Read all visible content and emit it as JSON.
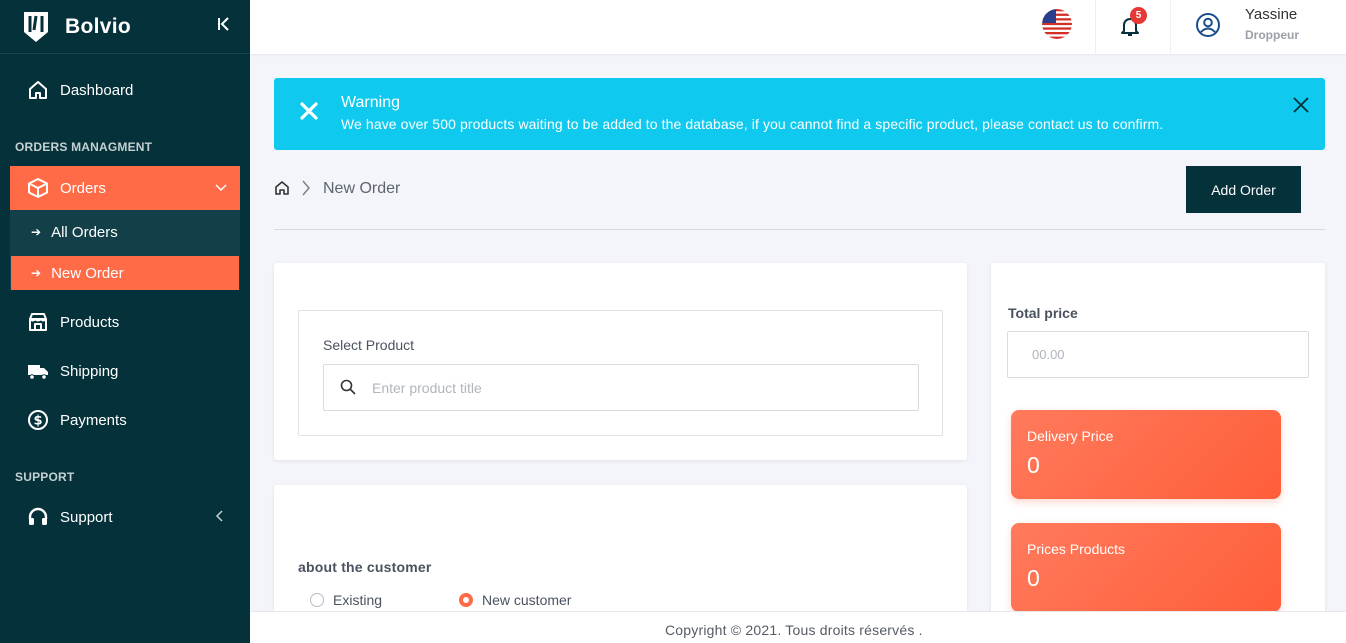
{
  "brand": {
    "name": "Bolvio"
  },
  "sidebar": {
    "dashboard": "Dashboard",
    "section_orders": "ORDERS MANAGMENT",
    "orders": "Orders",
    "sub": [
      "All Orders",
      "New Order"
    ],
    "products": "Products",
    "shipping": "Shipping",
    "payments": "Payments",
    "section_support": "SUPPORT",
    "support": "Support"
  },
  "topbar": {
    "notifications_count": "5",
    "user_name": "Yassine",
    "user_role": "Droppeur"
  },
  "alert": {
    "title": "Warning",
    "text": "We have over 500 products waiting to be added to the database, if you cannot find a specific product, please contact us to confirm."
  },
  "breadcrumb": {
    "current": "New Order"
  },
  "actions": {
    "add_order": "Add Order"
  },
  "product": {
    "label": "Select Product",
    "placeholder": "Enter product title"
  },
  "customer": {
    "title": "about the customer",
    "options": [
      "Existing",
      "New customer"
    ],
    "selected": "New customer"
  },
  "pricing": {
    "total_label": "Total price",
    "total_placeholder": "00.00",
    "delivery_label": "Delivery Price",
    "delivery_value": "0",
    "products_label": "Prices Products",
    "products_value": "0"
  },
  "footer": {
    "text": "Copyright © 2021. Tous droits réservés ."
  },
  "colors": {
    "sidebar": "#05313a",
    "accent": "#ff6b47",
    "alert": "#0fcaee"
  }
}
